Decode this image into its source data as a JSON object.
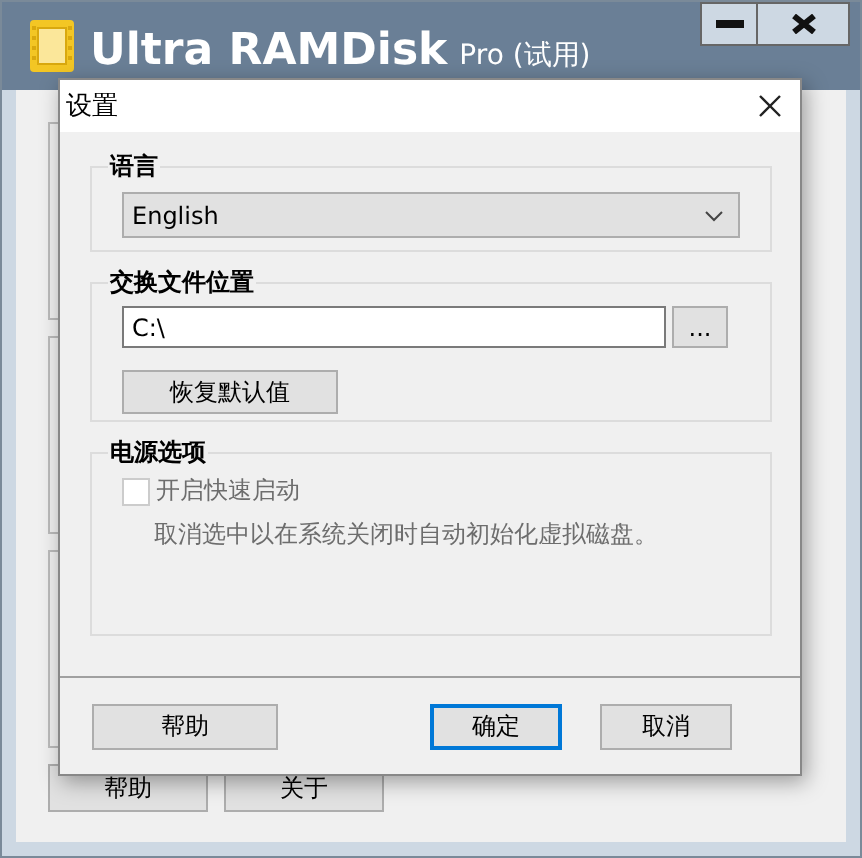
{
  "main_window": {
    "title": "Ultra RAMDisk",
    "edition": "Pro (试用)",
    "buttons": [
      "帮助",
      "关于"
    ]
  },
  "dialog": {
    "title": "设置",
    "language": {
      "label": "语言",
      "value": "English"
    },
    "swap": {
      "label": "交换文件位置",
      "value": "C:\\",
      "browse": "...",
      "reset": "恢复默认值"
    },
    "power": {
      "label": "电源选项",
      "options": [
        {
          "label": "开启快速启动",
          "checked": false,
          "disabled": true
        }
      ],
      "note": "取消选中以在系统关闭时自动初始化虚拟磁盘。"
    },
    "buttons": [
      {
        "label": "帮助",
        "default": false
      },
      {
        "label": "确定",
        "default": true
      },
      {
        "label": "取消",
        "default": false
      }
    ]
  }
}
